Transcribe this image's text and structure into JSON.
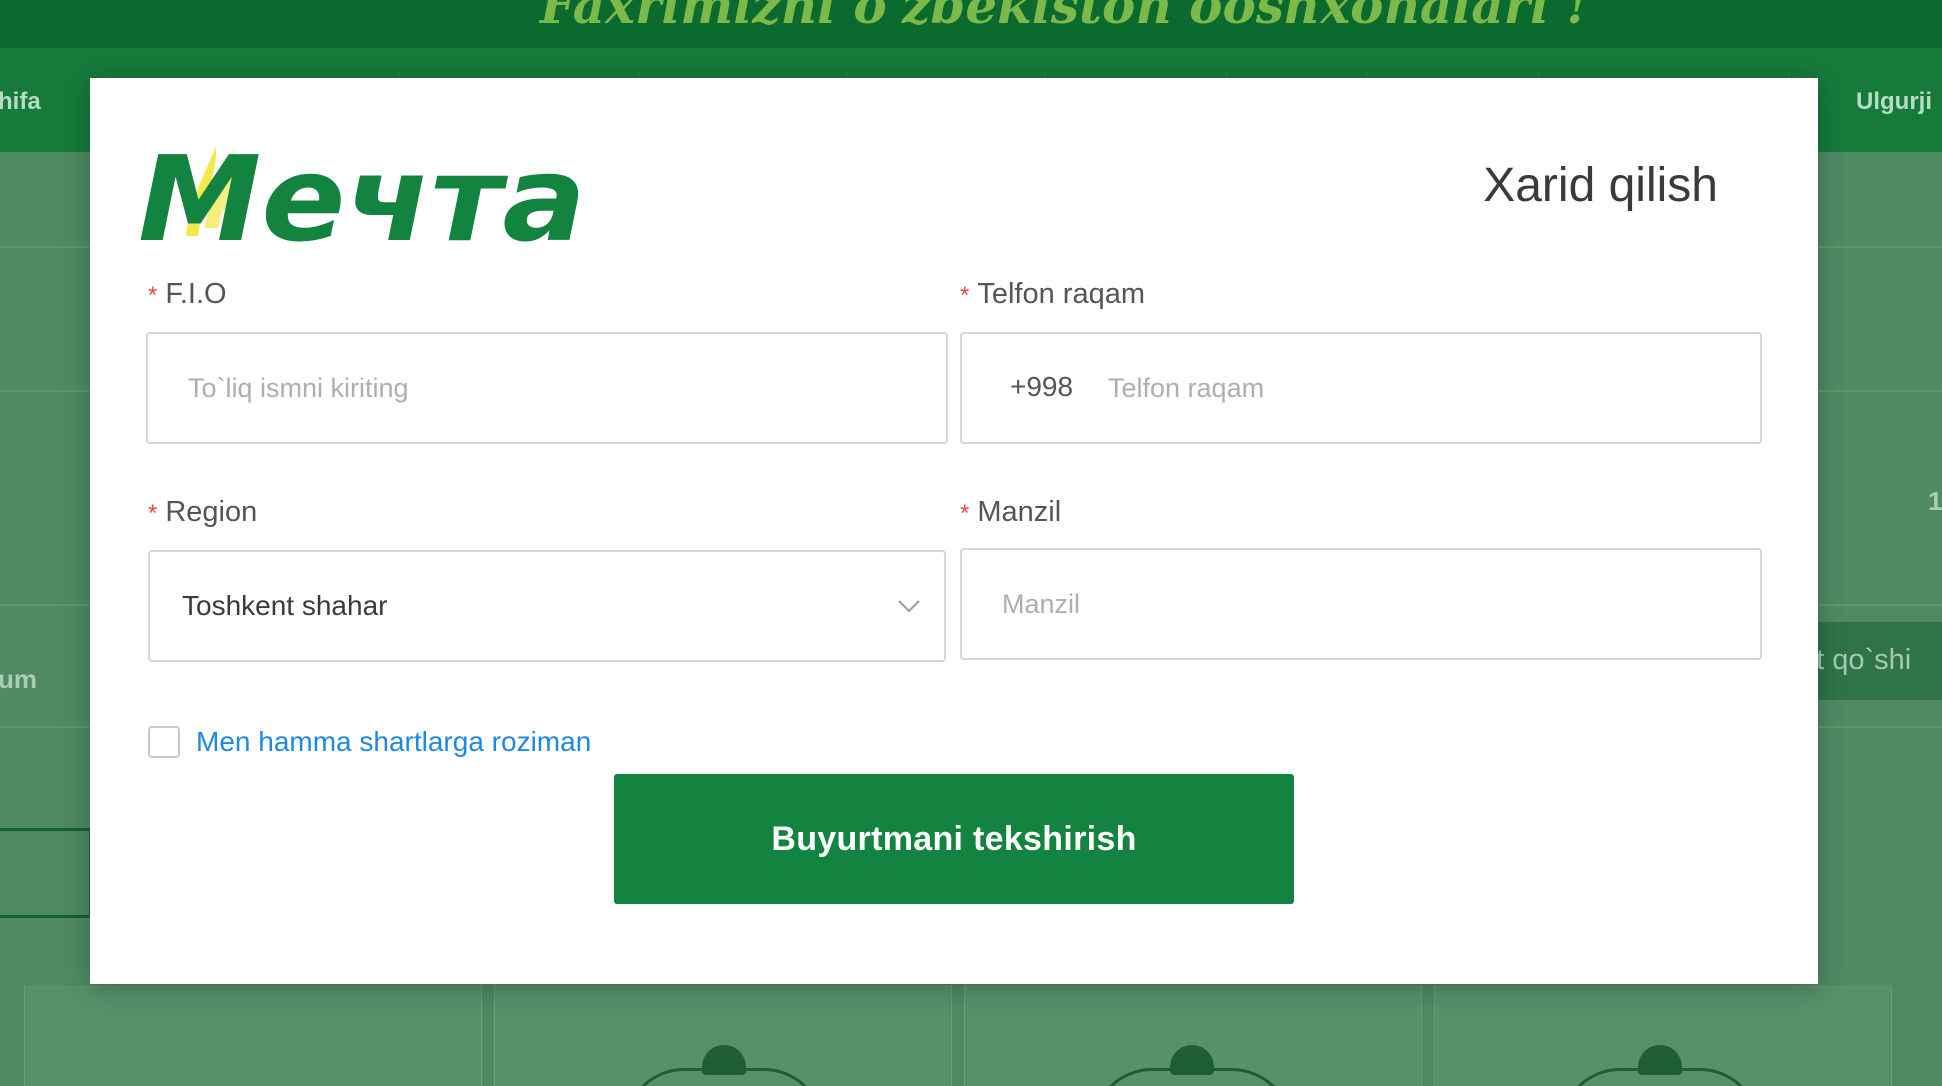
{
  "background": {
    "banner_text": "Faxrimizni o'zbekiston ooshxonalari !",
    "nav_left": "hifa",
    "nav_right": "Ulgurji",
    "side_left": "um",
    "side_right_num": "1",
    "side_button": "ot qo`shi"
  },
  "brand": {
    "logo_text": "Мечта",
    "primary": "#12843f",
    "accent": "#f4e94c"
  },
  "modal": {
    "title": "Xarid qilish",
    "fio": {
      "label": "F.I.O",
      "placeholder": "To`liq ismni kiriting",
      "value": ""
    },
    "phone": {
      "label": "Telfon raqam",
      "prefix": "+998",
      "placeholder": "Telfon raqam",
      "value": ""
    },
    "region": {
      "label": "Region",
      "selected": "Toshkent shahar"
    },
    "address": {
      "label": "Manzil",
      "placeholder": "Manzil",
      "value": ""
    },
    "required_mark": "*",
    "terms_label": "Men hamma shartlarga roziman",
    "terms_checked": false,
    "submit_label": "Buyurtmani tekshirish"
  }
}
